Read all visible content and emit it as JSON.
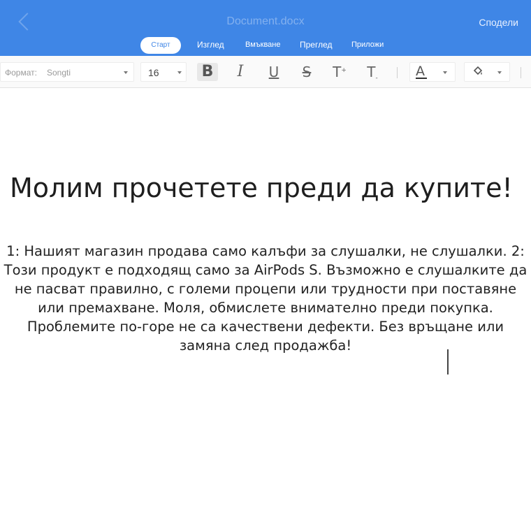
{
  "header": {
    "doc_title": "Document.docx",
    "share_label": "Сподели",
    "accent_color": "#3f86e6"
  },
  "tabs": [
    {
      "label": "Старт",
      "active": true
    },
    {
      "label": "Изглед",
      "active": false
    },
    {
      "label": "Вмъкване",
      "active": false
    },
    {
      "label": "Преглед",
      "active": false
    },
    {
      "label": "Приложи",
      "active": false
    }
  ],
  "toolbar": {
    "format_label": "Формат:",
    "format_value": "Songti",
    "font_size": "16",
    "bold_glyph": "B",
    "italic_glyph": "I",
    "underline_glyph": "U",
    "strike_glyph": "S",
    "superscript_glyph": "T",
    "subscript_glyph": "T",
    "font_color_glyph": "A",
    "icons": [
      "chevron-down-icon",
      "bold-icon",
      "italic-icon",
      "underline-icon",
      "strikethrough-icon",
      "superscript-icon",
      "subscript-icon",
      "font-color-icon",
      "fill-color-icon"
    ]
  },
  "document": {
    "heading": "Молим прочетете преди да купите!",
    "body": "1: Нашият магазин продава само калъфи за слушалки, не слушалки. 2: Този продукт е подходящ само за AirPods S. Възможно е слушалките да не пасват правилно, с големи процепи или трудности при поставяне или премахване. Моля, обмислете внимателно преди покупка. Проблемите по-горе не са качествени дефекти. Без връщане или замяна след продажба!"
  }
}
